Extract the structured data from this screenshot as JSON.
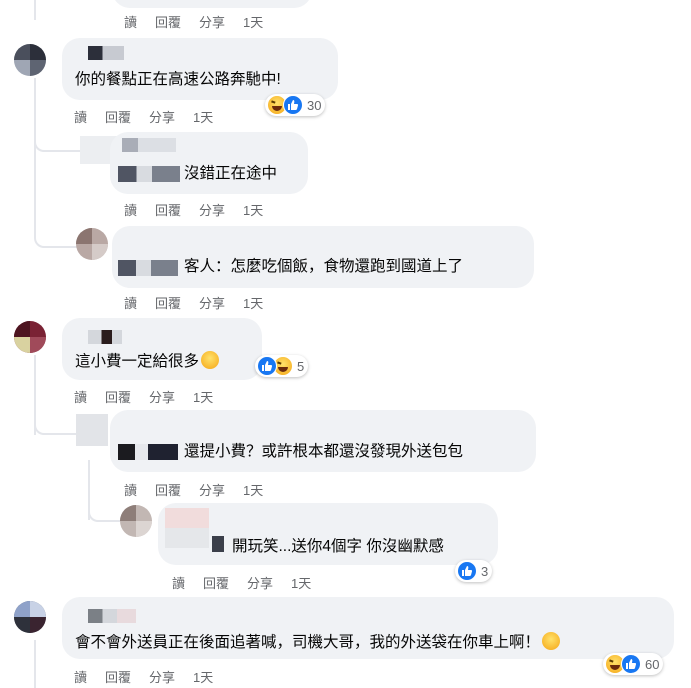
{
  "actions": {
    "read": "讀",
    "reply": "回覆",
    "share": "分享",
    "time": "1天"
  },
  "comments": [
    {
      "text": "你的餐點正在高速公路奔馳中!",
      "reaction_count": "30",
      "reactions": [
        "haha-icon",
        "like-icon"
      ]
    },
    {
      "text": "沒錯正在途中"
    },
    {
      "text": "客人：怎麼吃個飯，食物還跑到國道上了"
    },
    {
      "text": "這小費一定給很多",
      "reaction_count": "5",
      "reactions": [
        "like-icon",
        "haha-icon"
      ]
    },
    {
      "text": "還提小費？或許根本都還沒發現外送包包"
    },
    {
      "text": "開玩笑...送你4個字 你沒幽默感",
      "reaction_count": "3",
      "reactions": [
        "like-icon"
      ]
    },
    {
      "text": "會不會外送員正在後面追著喊，司機大哥，我的外送袋在你車上啊！",
      "reaction_count": "60",
      "reactions": [
        "haha-icon",
        "like-icon"
      ]
    }
  ],
  "colors": {
    "bubble": "#f0f2f5",
    "action_text": "#65676b",
    "like_blue": "#1877f2",
    "haha_yellow": "#f7b125"
  }
}
